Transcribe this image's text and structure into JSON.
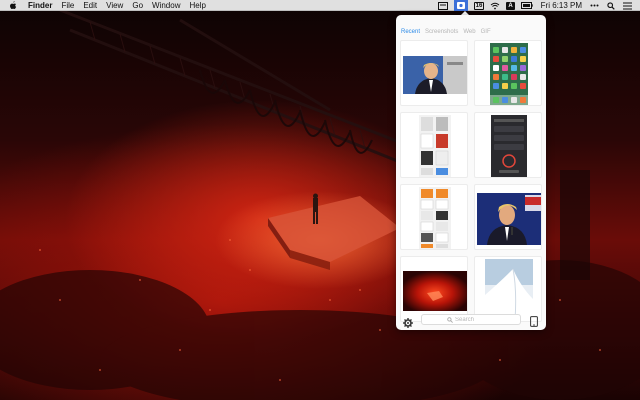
{
  "menubar": {
    "apple_icon": "apple-logo-icon",
    "app_name": "Finder",
    "items": [
      "File",
      "Edit",
      "View",
      "Go",
      "Window",
      "Help"
    ],
    "status_icons": [
      "cast-icon",
      "screenshot-app-icon",
      "calendar-icon",
      "wifi-icon",
      "text-input-icon",
      "battery-icon"
    ],
    "calendar_badge": "16",
    "input_badge": "A",
    "clock": "Fri 6:13 PM",
    "right_icons": [
      "more-icon",
      "search-icon",
      "menu-list-icon"
    ]
  },
  "popover": {
    "tabs": [
      "Recent",
      "Screenshots",
      "Web",
      "GIF"
    ],
    "active_tab": "Recent",
    "thumbnails": [
      "person-photo",
      "phone-home-screen",
      "document-pages",
      "phone-app-screen",
      "document-grid",
      "person-photo-flags",
      "concert-photo",
      "snow-landscape"
    ],
    "search_placeholder": "Search",
    "footer_icons": [
      "gear-icon",
      "search-icon",
      "phone-icon"
    ]
  },
  "colors": {
    "accent": "#2f8ce8",
    "menubar_bg": "#ececec",
    "active_status_bg": "#3a6fd8",
    "wallpaper_red": "#c81e10"
  }
}
